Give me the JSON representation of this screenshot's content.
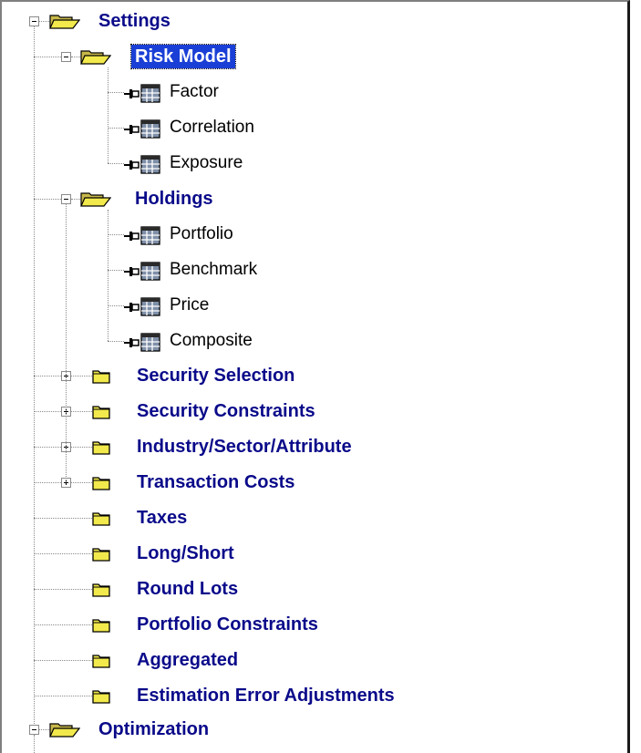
{
  "tree": {
    "root": {
      "label": "Settings",
      "expanded": true,
      "icon": "folder-open-icon"
    },
    "groups": [
      {
        "label": "Risk Model",
        "selected": true,
        "expanded": true,
        "icon": "folder-open-icon",
        "children": [
          "Factor",
          "Correlation",
          "Exposure"
        ]
      },
      {
        "label": "Holdings",
        "selected": false,
        "expanded": true,
        "icon": "folder-open-icon",
        "children": [
          "Portfolio",
          "Benchmark",
          "Price",
          "Composite"
        ]
      }
    ],
    "collapsed_folders": [
      {
        "label": "Security Selection",
        "expandable": true
      },
      {
        "label": "Security Constraints",
        "expandable": true
      },
      {
        "label": "Industry/Sector/Attribute",
        "expandable": true
      },
      {
        "label": "Transaction Costs",
        "expandable": true
      },
      {
        "label": "Taxes",
        "expandable": false
      },
      {
        "label": "Long/Short",
        "expandable": false
      },
      {
        "label": "Round Lots",
        "expandable": false
      },
      {
        "label": "Portfolio Constraints",
        "expandable": false
      },
      {
        "label": "Aggregated",
        "expandable": false
      },
      {
        "label": "Estimation Error Adjustments",
        "expandable": false
      }
    ],
    "root2": {
      "label": "Optimization",
      "expanded": true,
      "icon": "folder-open-icon"
    },
    "leaf_icon": "pushpin-table-icon",
    "closed_folder_icon": "folder-closed-icon",
    "colors": {
      "label_bold": "#0a0a8a",
      "selection": "#1a3fd6",
      "folder_yellow": "#f2e94c",
      "table_icon": "#7f8fa8"
    }
  }
}
